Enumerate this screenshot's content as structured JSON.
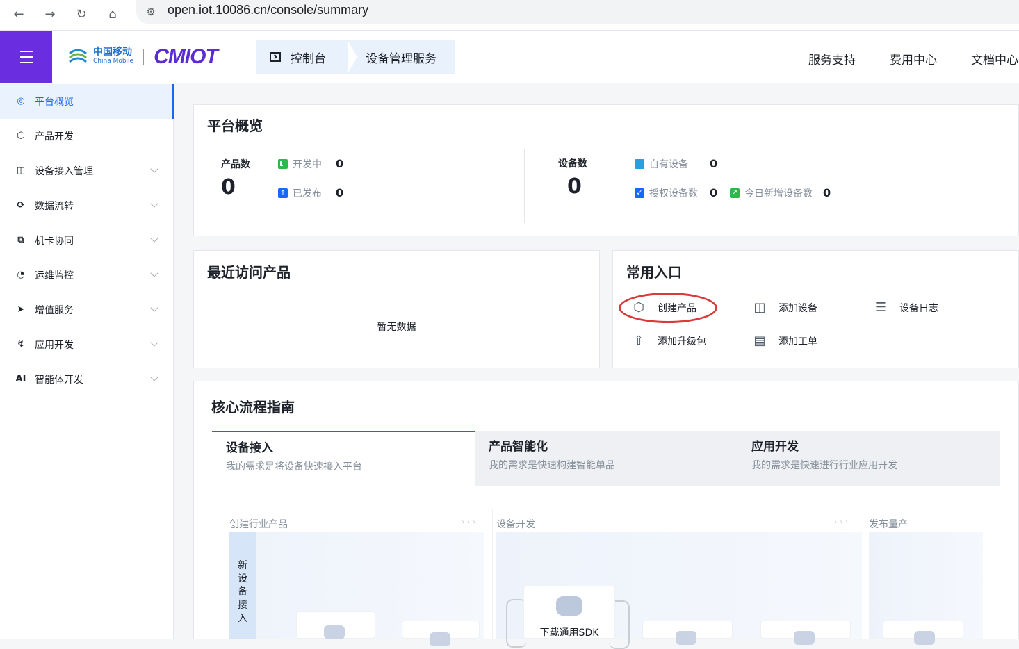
{
  "browser": {
    "url": "open.iot.10086.cn/console/summary",
    "icons": [
      "back-icon",
      "forward-icon",
      "reload-icon",
      "home-icon",
      "site-settings-icon"
    ]
  },
  "header": {
    "logo_cn": "中国移动",
    "logo_en": "China Mobile",
    "logo_brand": "CMIOT",
    "breadcrumb": [
      "控制台",
      "设备管理服务"
    ],
    "right_links": [
      "服务支持",
      "费用中心",
      "文档中心"
    ]
  },
  "sidebar": {
    "items": [
      {
        "label": "平台概览",
        "icon": "overview-icon",
        "active": true,
        "expandable": false
      },
      {
        "label": "产品开发",
        "icon": "cube-icon",
        "active": false,
        "expandable": false
      },
      {
        "label": "设备接入管理",
        "icon": "device-access-icon",
        "active": false,
        "expandable": true
      },
      {
        "label": "数据流转",
        "icon": "data-flow-icon",
        "active": false,
        "expandable": true
      },
      {
        "label": "机卡协同",
        "icon": "card-sync-icon",
        "active": false,
        "expandable": true
      },
      {
        "label": "运维监控",
        "icon": "monitor-icon",
        "active": false,
        "expandable": true
      },
      {
        "label": "增值服务",
        "icon": "value-added-icon",
        "active": false,
        "expandable": true
      },
      {
        "label": "应用开发",
        "icon": "app-dev-icon",
        "active": false,
        "expandable": true
      },
      {
        "label": "智能体开发",
        "icon": "ai-icon",
        "active": false,
        "expandable": true
      }
    ]
  },
  "overview": {
    "title": "平台概览",
    "products": {
      "label": "产品数",
      "value": "0",
      "developing_label": "开发中",
      "developing_value": "0",
      "published_label": "已发布",
      "published_value": "0"
    },
    "devices": {
      "label": "设备数",
      "value": "0",
      "own_label": "自有设备",
      "own_value": "0",
      "authorized_label": "授权设备数",
      "authorized_value": "0",
      "today_new_label": "今日新增设备数",
      "today_new_value": "0"
    }
  },
  "recent": {
    "title": "最近访问产品",
    "empty": "暂无数据"
  },
  "quick": {
    "title": "常用入口",
    "entries": [
      {
        "label": "创建产品",
        "icon": "box-icon"
      },
      {
        "label": "添加设备",
        "icon": "add-device-icon"
      },
      {
        "label": "设备日志",
        "icon": "log-icon"
      },
      {
        "label": "添加升级包",
        "icon": "upload-icon"
      },
      {
        "label": "添加工单",
        "icon": "ticket-icon"
      }
    ]
  },
  "guide": {
    "title": "核心流程指南",
    "tabs": [
      {
        "title": "设备接入",
        "subtitle": "我的需求是将设备快速接入平台",
        "active": true
      },
      {
        "title": "产品智能化",
        "subtitle": "我的需求是快速构建智能单品",
        "active": false
      },
      {
        "title": "应用开发",
        "subtitle": "我的需求是快速进行行业应用开发",
        "active": false
      }
    ],
    "stages": [
      "创建行业产品",
      "设备开发",
      "发布量产"
    ],
    "new_device_tag": [
      "新",
      "设",
      "备",
      "接",
      "入"
    ],
    "sdk_label": "下载通用SDK"
  },
  "colors": {
    "accent": "#1667ff",
    "brand_purple": "#6a2ee0",
    "highlight_ring": "#d93a3a"
  }
}
